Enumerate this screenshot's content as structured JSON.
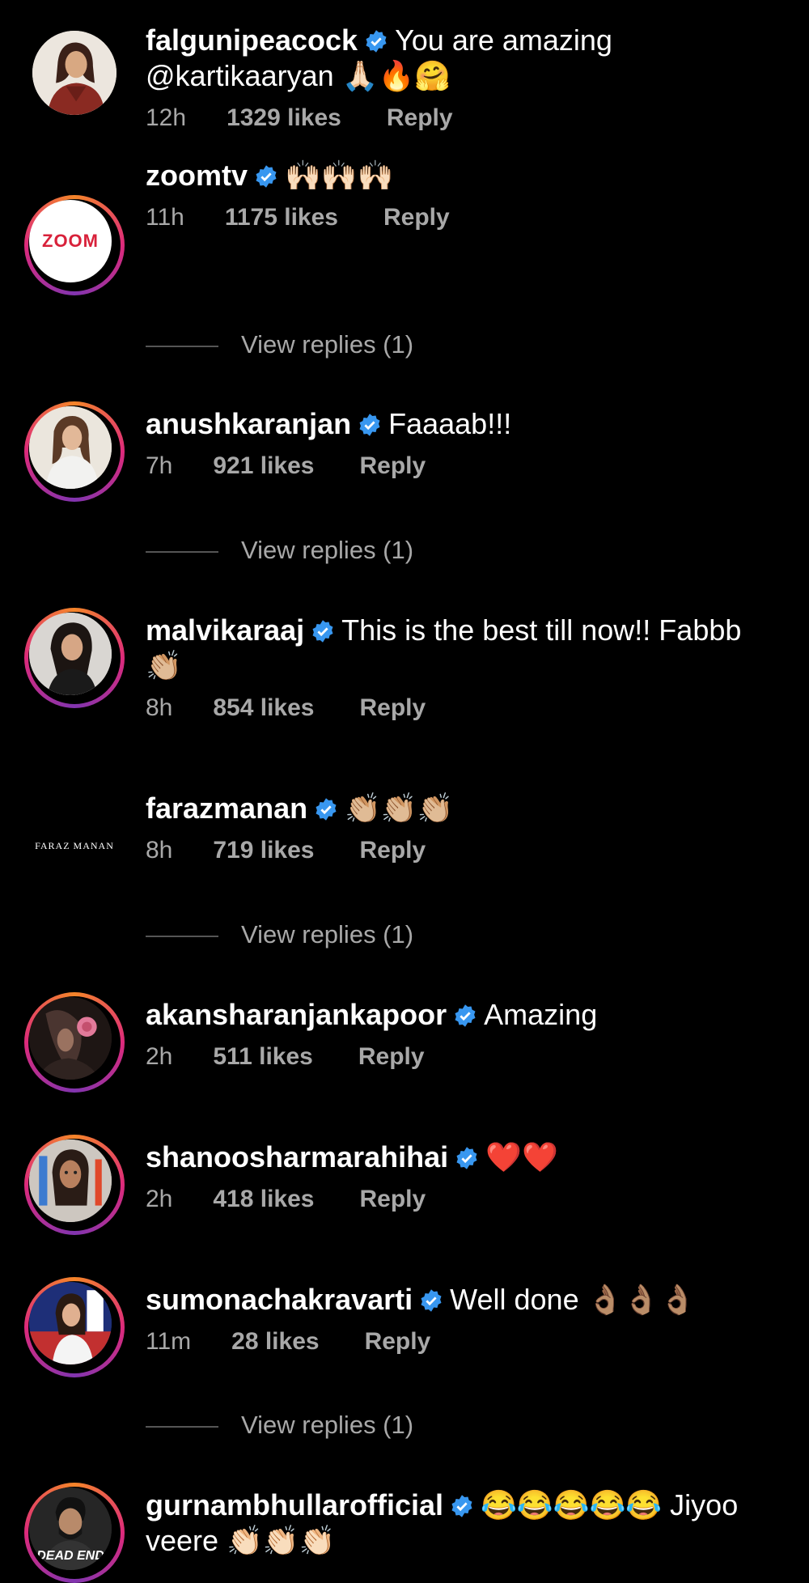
{
  "comments": [
    {
      "username": "falgunipeacock",
      "text": "You are amazing @kartikaaryan 🙏🏻🔥🤗",
      "time": "12h",
      "likes": "1329 likes",
      "reply": "Reply",
      "avatar": "portrait-woman-red",
      "avatar_ring": false
    },
    {
      "username": "zoomtv",
      "text": "🙌🏻🙌🏻🙌🏻",
      "time": "11h",
      "likes": "1175 likes",
      "reply": "Reply",
      "avatar": "zoom-logo",
      "avatar_logo_text": "ZOOM",
      "avatar_ring": true,
      "view_replies": "View replies (1)"
    },
    {
      "username": "anushkaranjan",
      "text": "Faaaab!!!",
      "time": "7h",
      "likes": "921 likes",
      "reply": "Reply",
      "avatar": "portrait-woman-light",
      "avatar_ring": true,
      "view_replies": "View replies (1)"
    },
    {
      "username": "malvikaraaj",
      "text": "This is the best till now!! Fabbb 👏🏼",
      "time": "8h",
      "likes": "854 likes",
      "reply": "Reply",
      "avatar": "portrait-woman-dark",
      "avatar_ring": true
    },
    {
      "username": "farazmanan",
      "text": "👏🏼👏🏼👏🏼",
      "time": "8h",
      "likes": "719 likes",
      "reply": "Reply",
      "avatar": "faraz-manan-logo",
      "avatar_logo_text": "FARAZ MANAN",
      "avatar_ring": false,
      "view_replies": "View replies (1)"
    },
    {
      "username": "akansharanjankapoor",
      "text": "Amazing",
      "time": "2h",
      "likes": "511 likes",
      "reply": "Reply",
      "avatar": "portrait-rose",
      "avatar_ring": true
    },
    {
      "username": "shanoosharmarahihai",
      "text": "❤️❤️",
      "time": "2h",
      "likes": "418 likes",
      "reply": "Reply",
      "avatar": "portrait-woman-color",
      "avatar_ring": true
    },
    {
      "username": "sumonachakravarti",
      "text": "Well done 👌🏽👌🏽👌🏽",
      "time": "11m",
      "likes": "28 likes",
      "reply": "Reply",
      "avatar": "portrait-woman-flag",
      "avatar_ring": true,
      "view_replies": "View replies (1)"
    },
    {
      "username": "gurnambhullarofficial",
      "text": "😂😂😂😂😂 Jiyoo veere 👏🏻👏🏻👏🏻",
      "avatar": "dead-end-poster",
      "avatar_logo_text": "DEAD END",
      "avatar_ring": true
    }
  ],
  "colors": {
    "background": "#000000",
    "text": "#ffffff",
    "secondary_text": "#a8a8a8",
    "verified_badge": "#3897f0"
  }
}
